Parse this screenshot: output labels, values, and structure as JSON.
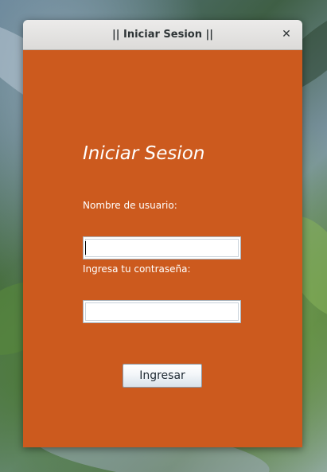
{
  "window": {
    "title": "|| Iniciar Sesion ||",
    "close_symbol": "✕"
  },
  "form": {
    "heading": "Iniciar Sesion",
    "username_label": "Nombre de usuario:",
    "username_value": "",
    "password_label": "Ingresa tu contraseña:",
    "password_value": "",
    "submit_label": "Ingresar"
  },
  "colors": {
    "form_background": "#cc5a1e",
    "titlebar": "#e4e3e1",
    "text_on_form": "#ffffff"
  },
  "icons": {
    "close": "close-icon"
  }
}
